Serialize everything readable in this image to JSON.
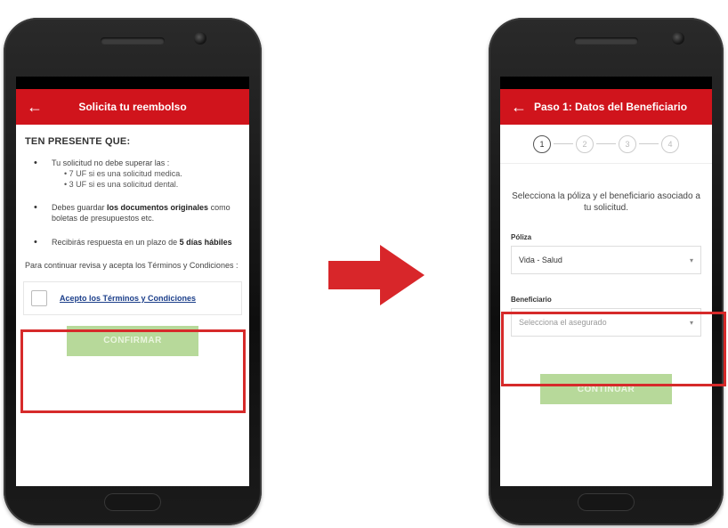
{
  "left_screen": {
    "title": "Solicita tu reembolso",
    "notice_heading": "TEN PRESENTE QUE:",
    "bullet1_intro": "Tu solicitud no debe superar las :",
    "bullet1_sub1": "• 7 UF si es una solicitud medica.",
    "bullet1_sub2": "• 3 UF si es una solicitud dental.",
    "bullet2_a": "Debes guardar ",
    "bullet2_b": "los documentos originales",
    "bullet2_c": " como boletas de presupuestos etc.",
    "bullet3_a": "Recibirás respuesta en un plazo de ",
    "bullet3_b": "5 días hábiles",
    "continue_text": "Para continuar revisa y acepta los Términos y Condiciones :",
    "terms_link": "Acepto los Términos y Condiciones",
    "button_label": "CONFIRMAR"
  },
  "right_screen": {
    "title": "Paso 1: Datos del Beneficiario",
    "steps": [
      "1",
      "2",
      "3",
      "4"
    ],
    "intro": "Selecciona la póliza y el beneficiario asociado a tu solicitud.",
    "policy_label": "Póliza",
    "policy_value": "Vida - Salud",
    "beneficiary_label": "Beneficiario",
    "beneficiary_placeholder": "Selecciona el asegurado",
    "button_label": "CONTINUAR"
  },
  "colors": {
    "app_bar": "#d0141c",
    "highlight": "#d62a2a",
    "disabled_button": "#b7d99a",
    "link": "#1b3e8a"
  },
  "icons": {
    "back": "←",
    "chevron": "▾"
  }
}
